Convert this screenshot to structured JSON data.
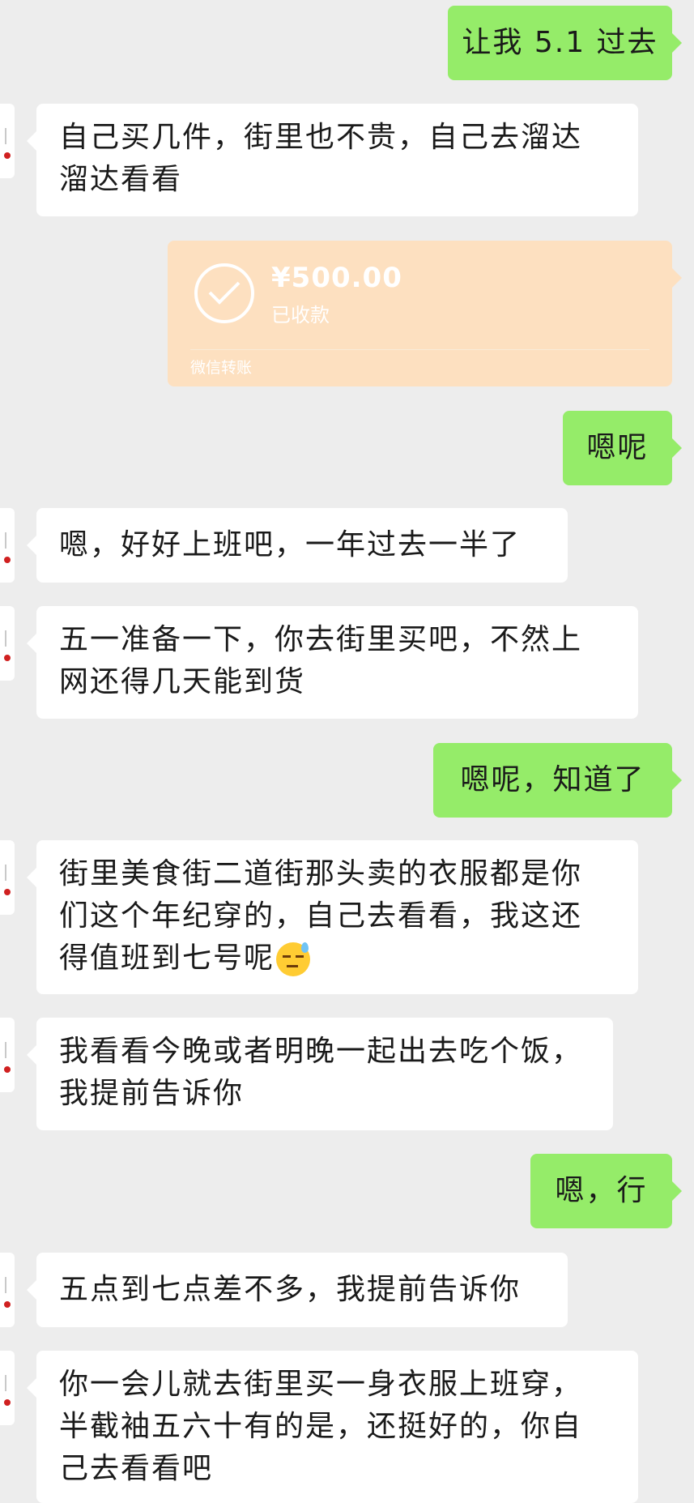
{
  "messages": [
    {
      "id": "m1",
      "side": "out",
      "text": "让我 5.1 过去"
    },
    {
      "id": "m2",
      "side": "in",
      "lines": [
        "自己买几件，街里也不贵，自己去溜达",
        "溜达看看"
      ]
    },
    {
      "id": "m3",
      "side": "out",
      "type": "transfer",
      "amount": "¥500.00",
      "status": "已收款",
      "source": "微信转账"
    },
    {
      "id": "m4",
      "side": "out",
      "text": "嗯呢"
    },
    {
      "id": "m5",
      "side": "in",
      "text": "嗯，好好上班吧，一年过去一半了"
    },
    {
      "id": "m6",
      "side": "in",
      "lines": [
        "五一准备一下，你去街里买吧，不然上",
        "网还得几天能到货"
      ]
    },
    {
      "id": "m7",
      "side": "out",
      "text": "嗯呢，知道了"
    },
    {
      "id": "m8",
      "side": "in",
      "lines": [
        "街里美食街二道街那头卖的衣服都是你",
        "们这个年纪穿的，自己去看看，我这还",
        "得值班到七号呢"
      ],
      "emoji": "downcast-sweat-face"
    },
    {
      "id": "m9",
      "side": "in",
      "lines": [
        "我看看今晚或者明晚一起出去吃个饭，",
        "我提前告诉你"
      ]
    },
    {
      "id": "m10",
      "side": "out",
      "text": "嗯，行"
    },
    {
      "id": "m11",
      "side": "in",
      "text": "五点到七点差不多，我提前告诉你"
    },
    {
      "id": "m12",
      "side": "in",
      "lines": [
        "你一会儿就去街里买一身衣服上班穿，",
        "半截袖五六十有的是，还挺好的，你自",
        "己去看看吧"
      ]
    }
  ],
  "colors": {
    "background": "#ededed",
    "outgoing_bubble": "#95ec69",
    "incoming_bubble": "#ffffff",
    "transfer_card": "#fde0c0"
  }
}
